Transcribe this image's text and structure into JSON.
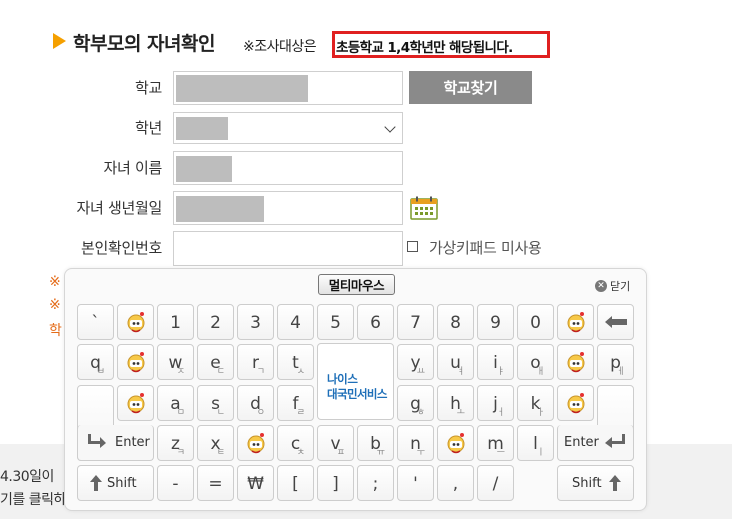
{
  "header": {
    "title": "학부모의 자녀확인",
    "note_prefix": "※조사대상은",
    "note_highlight": "초등학교 1,4학년만 해당됩니다."
  },
  "form": {
    "school_label": "학교",
    "grade_label": "학년",
    "child_name_label": "자녀 이름",
    "child_birth_label": "자녀 생년월일",
    "verify_code_label": "본인확인번호",
    "find_school_button": "학교찾기",
    "virtual_keypad_label": "가상키패드 미사용"
  },
  "partial_left": {
    "mark1": "※",
    "mark2": "※",
    "mark3": "학"
  },
  "partial_bottom": {
    "line1": "4.30일이",
    "line2": "기를 클릭하"
  },
  "keyboard": {
    "multi_mouse": "멀티마우스",
    "close_label": "닫기",
    "logo_line1": "나이스",
    "logo_line2": "대국민서비스",
    "enter": "Enter",
    "shift": "Shift",
    "row1": [
      "`",
      "@mascot",
      "1",
      "2",
      "3",
      "4",
      "5",
      "6",
      "7",
      "8",
      "9",
      "0",
      "@mascot",
      "@backspace"
    ],
    "row2": [
      [
        "q",
        "ㅂ"
      ],
      [
        "@mascot",
        ""
      ],
      [
        "w",
        "ㅈ"
      ],
      [
        "e",
        "ㄷ"
      ],
      [
        "r",
        "ㄱ"
      ],
      [
        "t",
        "ㅅ"
      ],
      [
        "y",
        "ㅛ"
      ],
      [
        "u",
        "ㅕ"
      ],
      [
        "i",
        "ㅑ"
      ],
      [
        "o",
        "ㅐ"
      ],
      [
        "@mascot",
        ""
      ],
      [
        "p",
        "ㅔ"
      ]
    ],
    "row3": [
      [
        "@mascot",
        ""
      ],
      [
        "a",
        "ㅁ"
      ],
      [
        "s",
        "ㄴ"
      ],
      [
        "d",
        "ㅇ"
      ],
      [
        "f",
        "ㄹ"
      ],
      [
        "g",
        "ㅎ"
      ],
      [
        "h",
        "ㅗ"
      ],
      [
        "j",
        "ㅓ"
      ],
      [
        "k",
        "ㅏ"
      ],
      [
        "@mascot",
        ""
      ]
    ],
    "row4": [
      [
        "z",
        "ㅋ"
      ],
      [
        "x",
        "ㅌ"
      ],
      [
        "@mascot",
        ""
      ],
      [
        "c",
        "ㅊ"
      ],
      [
        "v",
        "ㅍ"
      ],
      [
        "b",
        "ㅠ"
      ],
      [
        "n",
        "ㅜ"
      ],
      [
        "@mascot",
        ""
      ],
      [
        "m",
        "ㅡ"
      ],
      [
        "l",
        "ㅣ"
      ]
    ],
    "row5": [
      "-",
      "=",
      "₩",
      "[",
      "]",
      ";",
      "'",
      ",",
      "/"
    ]
  },
  "colors": {
    "accent_orange": "#f5a000",
    "highlight_box": "#e02020",
    "button_gray": "#8a8a8a",
    "logo_blue": "#1e6fb8"
  }
}
